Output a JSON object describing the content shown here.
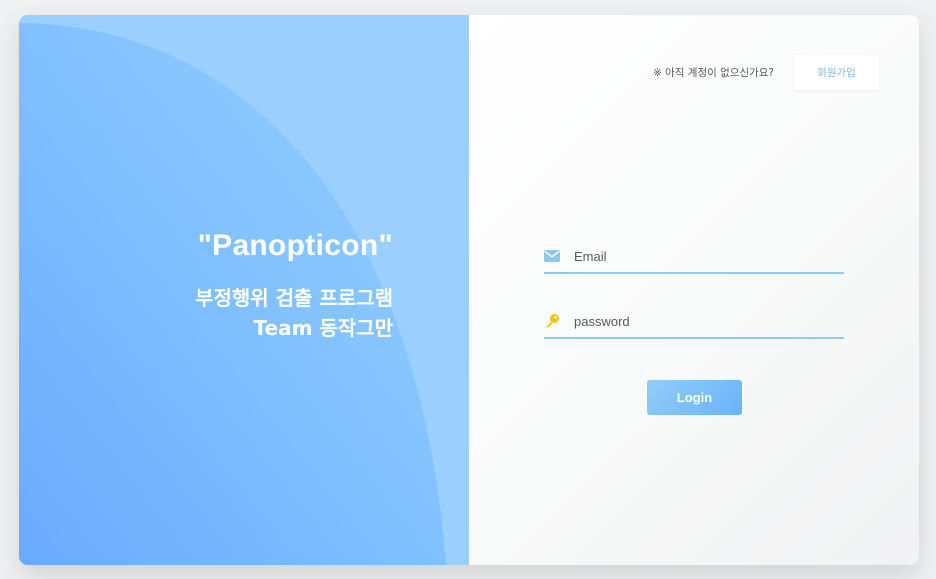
{
  "hero": {
    "title": "\"Panopticon\"",
    "subtitle_line1": "부정행위 검출 프로그램",
    "subtitle_line2": "Team 동작그만"
  },
  "signup": {
    "question": "※ 아직 계정이 없으신가요?",
    "button_label": "회원가입"
  },
  "form": {
    "email": {
      "placeholder": "Email",
      "value": "",
      "icon": "envelope-icon"
    },
    "password": {
      "placeholder": "password",
      "value": "",
      "icon": "key-icon"
    },
    "login_label": "Login"
  },
  "colors": {
    "hero_light": "#9bcffe",
    "hero_accent": "#6aaafd",
    "field_underline": "#8ccaf3",
    "login_start": "#93ccf8",
    "login_end": "#68b4fb",
    "signup_text": "#7fb8e6",
    "envelope_icon": "#8fc6f2",
    "key_icon": "#f5c400"
  }
}
